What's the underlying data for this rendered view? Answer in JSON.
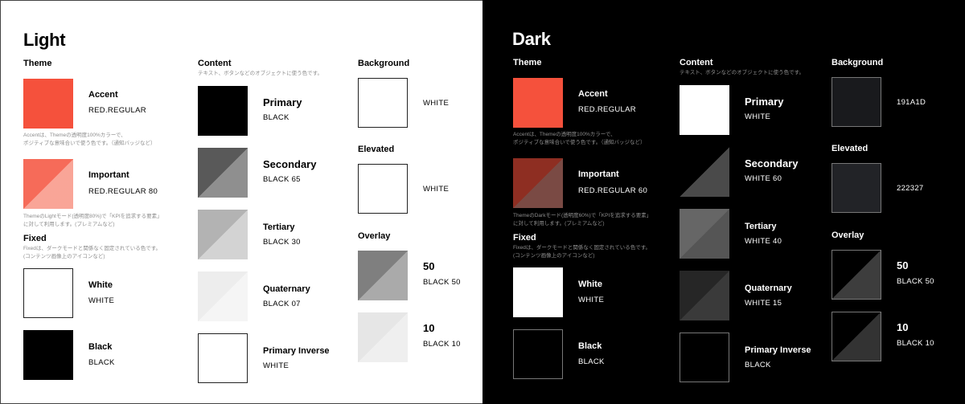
{
  "light": {
    "title": "Light",
    "theme": {
      "heading": "Theme",
      "accent": {
        "name": "Accent",
        "code": "RED.REGULAR",
        "color": "#F5513C"
      },
      "accent_desc": [
        "Accentは、Themeの透明度100%カラーで、",
        "ポジティブな意味合いで使う色です。（通知バッジなど）"
      ],
      "important": {
        "name": "Important",
        "code": "RED.REGULAR 80",
        "color": "#F5513C"
      },
      "important_desc": [
        "ThemeのLightモード(透明度80%)で「KPIを追求する要素」",
        "に対して利用します。(プレミアムなど)"
      ]
    },
    "fixed": {
      "heading": "Fixed",
      "desc": [
        "Fixedは、ダークモードと関係なく固定されている色です。",
        "(コンテンツ画像上のアイコンなど)"
      ],
      "white": {
        "name": "White",
        "code": "WHITE"
      },
      "black": {
        "name": "Black",
        "code": "BLACK"
      }
    },
    "content": {
      "heading": "Content",
      "desc": "テキスト、ボタンなどのオブジェクトに使う色です。",
      "primary": {
        "name": "Primary",
        "code": "BLACK"
      },
      "secondary": {
        "name": "Secondary",
        "code": "BLACK 65"
      },
      "tertiary": {
        "name": "Tertiary",
        "code": "BLACK 30"
      },
      "quaternary": {
        "name": "Quaternary",
        "code": "BLACK 07"
      },
      "inverse": {
        "name": "Primary Inverse",
        "code": "WHITE"
      }
    },
    "background": {
      "heading": "Background",
      "code": "WHITE"
    },
    "elevated": {
      "heading": "Elevated",
      "code": "WHITE"
    },
    "overlay": {
      "heading": "Overlay",
      "o50": {
        "name": "50",
        "code": "BLACK 50"
      },
      "o10": {
        "name": "10",
        "code": "BLACK 10"
      }
    }
  },
  "dark": {
    "title": "Dark",
    "theme": {
      "heading": "Theme",
      "accent": {
        "name": "Accent",
        "code": "RED.REGULAR",
        "color": "#F5513C"
      },
      "accent_desc": [
        "Accentは、Themeの透明度100%カラーで、",
        "ポジティブな意味合いで使う色です。（通知バッジなど）"
      ],
      "important": {
        "name": "Important",
        "code": "RED.REGULAR 60",
        "color": "#8E2E22"
      },
      "important_desc": [
        "ThemeのDarkモード(透明度60%)で「KPIを追求する要素」",
        "に対して利用します。(プレミアムなど)"
      ]
    },
    "fixed": {
      "heading": "Fixed",
      "desc": [
        "Fixedは、ダークモードと関係なく固定されている色です。",
        "(コンテンツ画像上のアイコンなど)"
      ],
      "white": {
        "name": "White",
        "code": "WHITE"
      },
      "black": {
        "name": "Black",
        "code": "BLACK"
      }
    },
    "content": {
      "heading": "Content",
      "desc": "テキスト、ボタンなどのオブジェクトに使う色です。",
      "primary": {
        "name": "Primary",
        "code": "WHITE"
      },
      "secondary": {
        "name": "Secondary",
        "code": "WHITE 60"
      },
      "tertiary": {
        "name": "Tertiary",
        "code": "WHITE 40"
      },
      "quaternary": {
        "name": "Quaternary",
        "code": "WHITE 15"
      },
      "inverse": {
        "name": "Primary Inverse",
        "code": "BLACK"
      }
    },
    "background": {
      "heading": "Background",
      "code": "191A1D",
      "color": "#191A1D"
    },
    "elevated": {
      "heading": "Elevated",
      "code": "222327",
      "color": "#222327"
    },
    "overlay": {
      "heading": "Overlay",
      "o50": {
        "name": "50",
        "code": "BLACK 50"
      },
      "o10": {
        "name": "10",
        "code": "BLACK 10"
      }
    }
  }
}
